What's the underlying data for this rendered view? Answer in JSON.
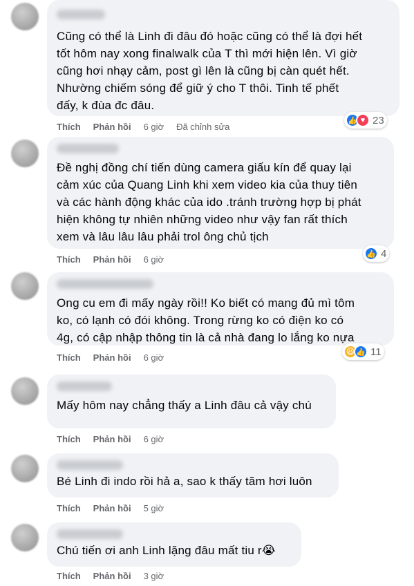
{
  "comments": [
    {
      "lines": [
        "Cũng có thể là Linh đi đâu đó hoặc cũng có thể là đợi hết",
        "tốt hôm nay xong finalwalk của T thì mới hiện lên. Vì giờ",
        "cũng hơi nhạy cảm, post gì lên là cũng bị càn quét hết.",
        "Nhường chiếm sóng để giữ ý cho T thôi. Tinh tế phết",
        "đấy, k đùa đc đâu."
      ],
      "like_label": "Thích",
      "reply_label": "Phản hồi",
      "time": "6 giờ",
      "edited": "Đã chỉnh sửa",
      "reactions": [
        "like",
        "love"
      ],
      "reaction_count": "23"
    },
    {
      "lines": [
        "Đề nghị đồng chí tiến dùng camera giấu kín để quay lại",
        "cảm xúc của Quang Linh khi xem video kia của thuy tiên",
        "và các hành động khác của ido .tránh trường hợp bị phát",
        "hiện không tự nhiên những video như vậy fan rất thích",
        "xem và lâu lâu lâu phải trol ông chủ tịch"
      ],
      "like_label": "Thích",
      "reply_label": "Phản hồi",
      "time": "6 giờ",
      "reactions": [
        "like"
      ],
      "reaction_count": "4"
    },
    {
      "lines": [
        "Ong cu em đi mấy ngày rồi!! Ko biết có mang đủ mì tôm",
        "ko, có lạnh có đói không. Trong rừng ko có điện ko có",
        "4g, có cập nhập thông tin là cả nhà đang lo lắng ko nựa"
      ],
      "like_label": "Thích",
      "reply_label": "Phản hồi",
      "time": "6 giờ",
      "reactions": [
        "haha",
        "like"
      ],
      "reaction_count": "11"
    },
    {
      "lines": [
        "Mấy hôm nay chẳng thấy a Linh đâu cả vậy chú"
      ],
      "like_label": "Thích",
      "reply_label": "Phản hồi",
      "time": "6 giờ"
    },
    {
      "lines": [
        "Bé Linh đi indo rồi hả a, sao k thấy tăm hơi luôn"
      ],
      "like_label": "Thích",
      "reply_label": "Phản hồi",
      "time": "5 giờ"
    },
    {
      "lines": [
        "Chú tiến ơi anh Linh lặng đâu mất tiu r😭"
      ],
      "like_label": "Thích",
      "reply_label": "Phản hồi",
      "time": "3 giờ"
    }
  ],
  "colors": {
    "bubble": "#f0f2f5",
    "meta_text": "#65676b",
    "like_blue": "#1877f2",
    "love_red": "#f33e58",
    "haha_yellow": "#f7b125"
  },
  "icons": {
    "like": "thumbs-up-icon",
    "love": "heart-icon",
    "haha": "laughing-face-icon"
  }
}
